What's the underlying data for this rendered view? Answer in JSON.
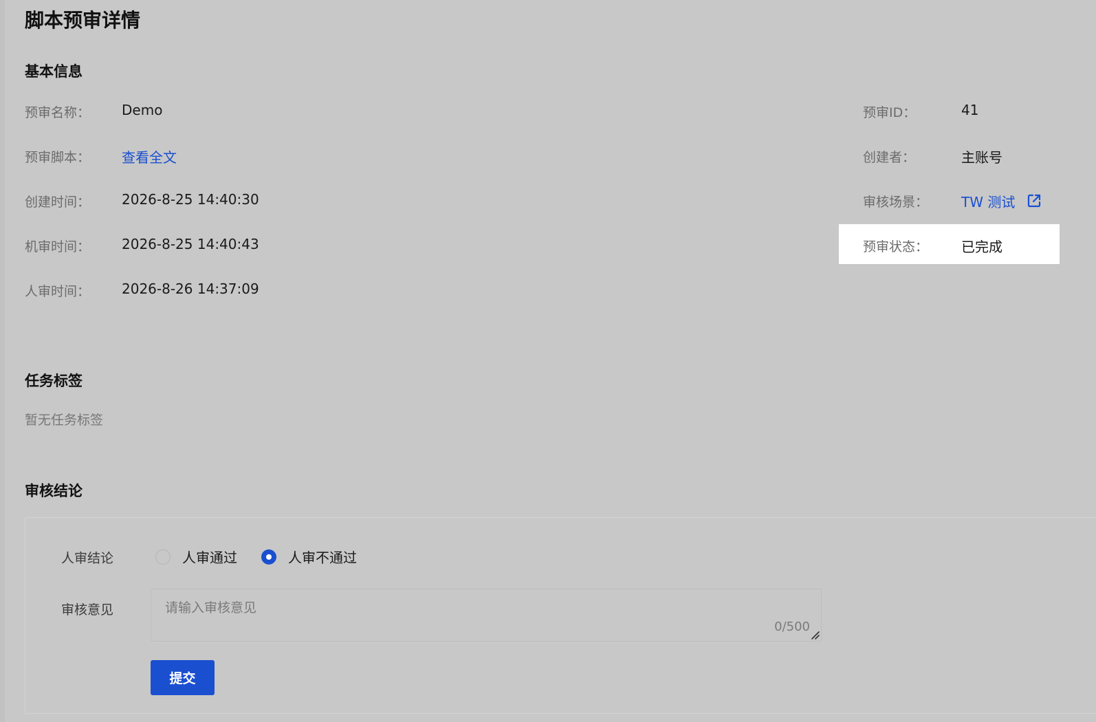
{
  "page": {
    "title": "脚本预审详情"
  },
  "basic_info": {
    "section_title": "基本信息",
    "left_fields": [
      {
        "label": "预审名称：",
        "value": "Demo"
      },
      {
        "label": "预审脚本：",
        "value": "查看全文"
      },
      {
        "label": "创建时间：",
        "value": "2026-8-25 14:40:30"
      },
      {
        "label": "机审时间：",
        "value": "2026-8-25 14:40:43"
      },
      {
        "label": "人审时间：",
        "value": "2026-8-26 14:37:09"
      }
    ],
    "right_fields": [
      {
        "label": "预审ID：",
        "value": "41"
      },
      {
        "label": "创建者：",
        "value": "主账号"
      },
      {
        "label": "审核场景：",
        "value": "TW 测试"
      },
      {
        "label": "预审状态：",
        "value": "已完成"
      }
    ]
  },
  "task_tags": {
    "section_title": "任务标签",
    "empty_text": "暂无任务标签"
  },
  "review": {
    "section_title": "审核结论",
    "conclusion_label": "人审结论",
    "options": [
      {
        "label": "人审通过",
        "checked": false
      },
      {
        "label": "人审不通过",
        "checked": true
      }
    ],
    "opinion_label": "审核意见",
    "opinion_placeholder": "请输入审核意见",
    "opinion_value": "",
    "char_count": "0/500",
    "submit_label": "提交"
  },
  "colors": {
    "background": "#c8c8c8",
    "link": "#1a4fd0",
    "primary_button": "#1a4fd0",
    "highlight": "#ffffff"
  },
  "icons": {
    "scene_link": "external-link-icon"
  }
}
